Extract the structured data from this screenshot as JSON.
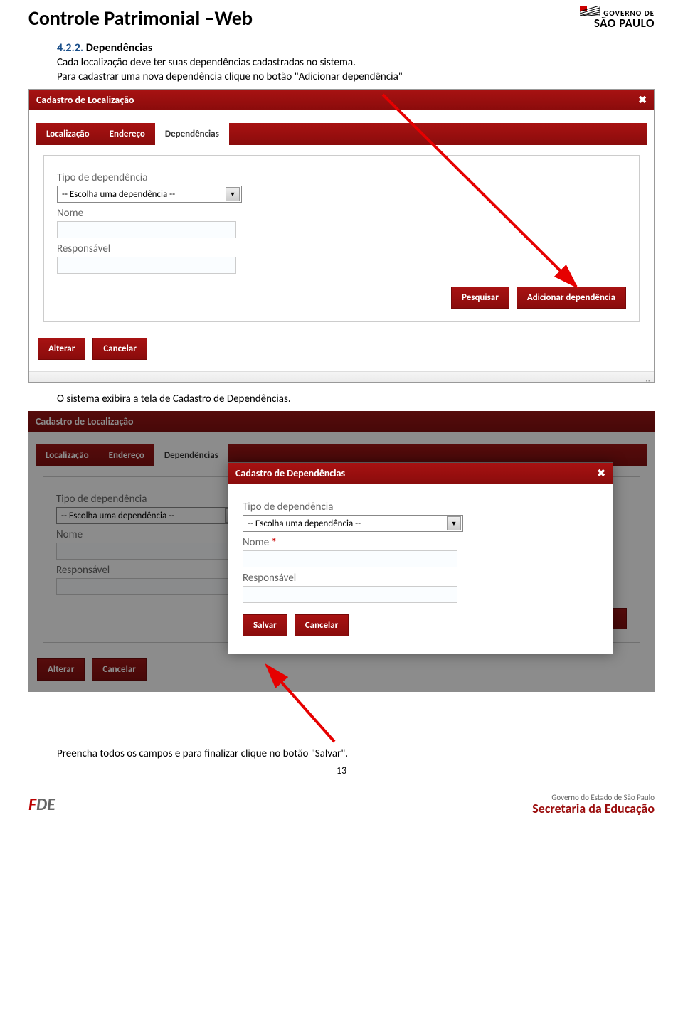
{
  "header": {
    "title": "Controle Patrimonial –Web",
    "gov_line1": "GOVERNO DE",
    "gov_line2": "SÃO PAULO"
  },
  "section": {
    "number": "4.2.2.",
    "title": "Dependências",
    "para1": "Cada localização deve ter suas dependências cadastradas no sistema.",
    "para2": "Para cadastrar uma nova dependência clique no botão \"Adicionar dependência\"",
    "para3": "O sistema exibira a tela de Cadastro de Dependências.",
    "para4": "Preencha todos os campos e para finalizar clique no botão \"Salvar\"."
  },
  "modal1": {
    "title": "Cadastro de Localização",
    "tabs": [
      "Localização",
      "Endereço",
      "Dependências"
    ],
    "form": {
      "lbl_tipo": "Tipo de dependência",
      "sel_placeholder": "-- Escolha uma dependência --",
      "lbl_nome": "Nome",
      "lbl_resp": "Responsável"
    },
    "btn_search": "Pesquisar",
    "btn_add": "Adicionar dependência",
    "btn_alter": "Alterar",
    "btn_cancel": "Cancelar"
  },
  "popup": {
    "title": "Cadastro de Dependências",
    "lbl_tipo": "Tipo de dependência",
    "sel_placeholder": "-- Escolha uma dependência --",
    "lbl_nome": "Nome",
    "lbl_resp": "Responsável",
    "btn_save": "Salvar",
    "btn_cancel": "Cancelar"
  },
  "footer": {
    "page": "13",
    "gov_state": "Governo do Estado de São Paulo",
    "secretaria": "Secretaria da Educação"
  }
}
